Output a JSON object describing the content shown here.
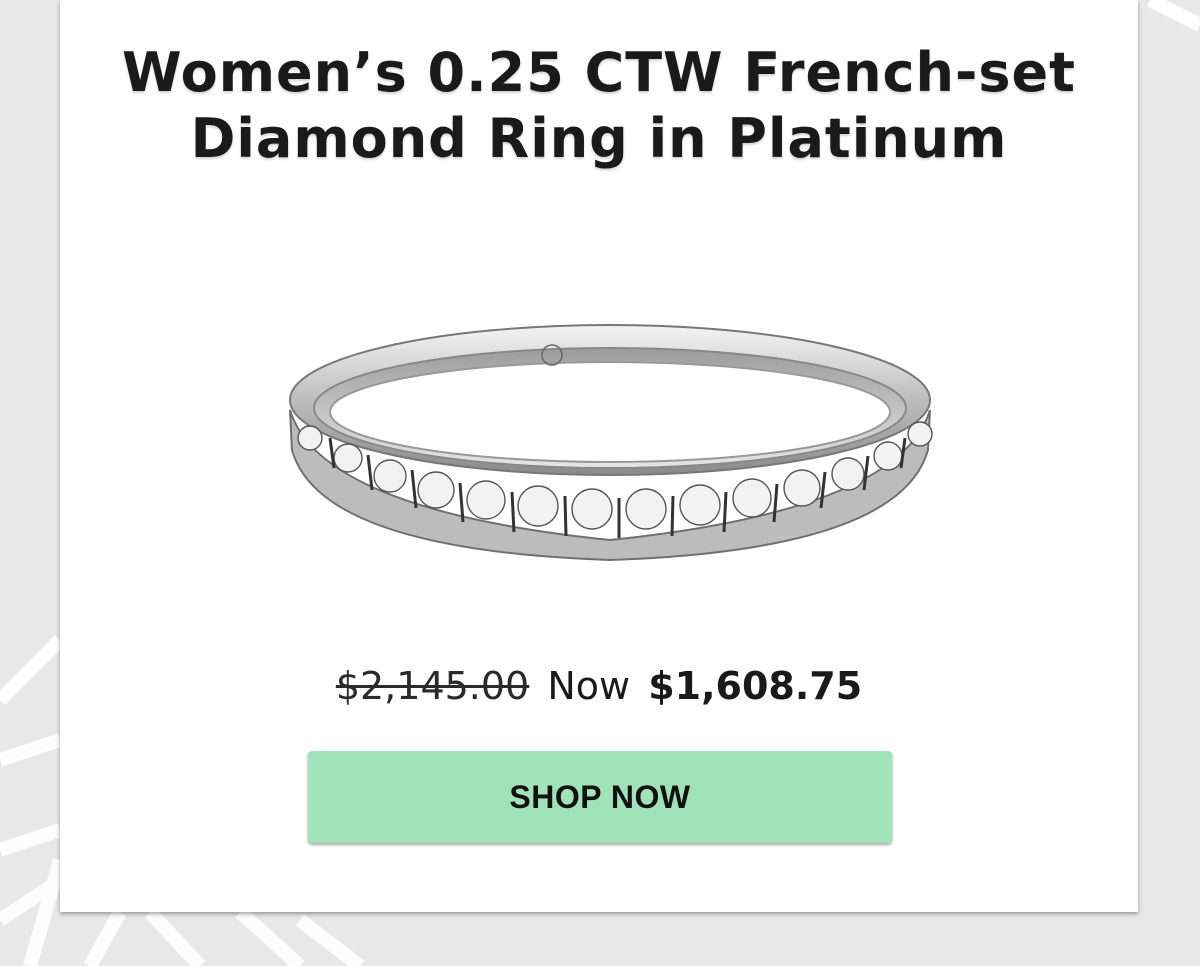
{
  "product": {
    "title_line1": "Women’s 0.25 CTW French-set",
    "title_line2": "Diamond Ring in Platinum",
    "image_alt": "Platinum French-set diamond ring"
  },
  "pricing": {
    "original_price": "$2,145.00",
    "now_label": "Now",
    "sale_price": "$1,608.75"
  },
  "cta": {
    "shop_label": "SHOP NOW"
  },
  "colors": {
    "button_bg": "#a1e3b8",
    "card_bg": "#ffffff",
    "page_bg": "#e8e8e8"
  }
}
